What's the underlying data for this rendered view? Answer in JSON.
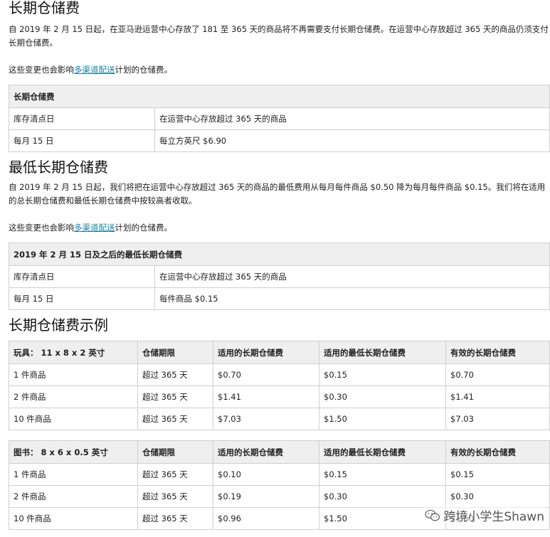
{
  "section1": {
    "title": "长期仓储费",
    "para1": "自 2019 年 2 月 15 日起，在亚马逊运营中心存放了 181 至 365 天的商品将不再需要支付长期仓储费。在运营中心存放超过 365 天的商品仍须支付长期仓储费。",
    "para2_pre": "这些变更也会影响",
    "link": "多渠道配送",
    "para2_post": "计划的仓储费。",
    "table": {
      "caption": "长期仓储费",
      "col1": "库存清点日",
      "col2": "在运营中心存放超过 365 天的商品",
      "row_c1": "每月 15 日",
      "row_c2": "每立方英尺 $6.90"
    }
  },
  "section2": {
    "title": "最低长期仓储费",
    "para1": "自 2019 年 2 月 15 日起，我们将把在运营中心存放超过 365 天的商品的最低费用从每月每件商品 $0.50 降为每月每件商品 $0.15。我们将在适用的总长期仓储费和最低长期仓储费中按较高者收取。",
    "para2_pre": "这些变更也会影响",
    "link": "多渠道配送",
    "para2_post": "计划的仓储费。",
    "table": {
      "caption": "2019 年 2 月 15 日及之后的最低长期仓储费",
      "col1": "库存清点日",
      "col2": "在运营中心存放超过 365 天的商品",
      "row_c1": "每月 15 日",
      "row_c2": "每件商品 $0.15"
    }
  },
  "section3": {
    "title": "长期仓储费示例",
    "headers": [
      "仓储期限",
      "适用的长期仓储费",
      "适用的最低长期仓储费",
      "有效的长期仓储费"
    ],
    "toys": {
      "label": "玩具：  11 x 8 x 2 英寸",
      "rows": [
        [
          "1 件商品",
          "超过 365 天",
          "$0.70",
          "$0.15",
          "$0.70"
        ],
        [
          "2 件商品",
          "超过 365 天",
          "$1.41",
          "$0.30",
          "$1.41"
        ],
        [
          "10 件商品",
          "超过 365 天",
          "$7.03",
          "$1.50",
          "$7.03"
        ]
      ]
    },
    "books": {
      "label": "图书：  8 x 6 x 0.5 英寸",
      "rows": [
        [
          "1 件商品",
          "超过 365 天",
          "$0.10",
          "$0.15",
          "$0.15"
        ],
        [
          "2 件商品",
          "超过 365 天",
          "$0.19",
          "$0.30",
          "$0.30"
        ],
        [
          "10 件商品",
          "超过 365 天",
          "$0.96",
          "$1.50",
          "$1.50"
        ]
      ]
    }
  },
  "watermark": "跨境小学生Shawn"
}
